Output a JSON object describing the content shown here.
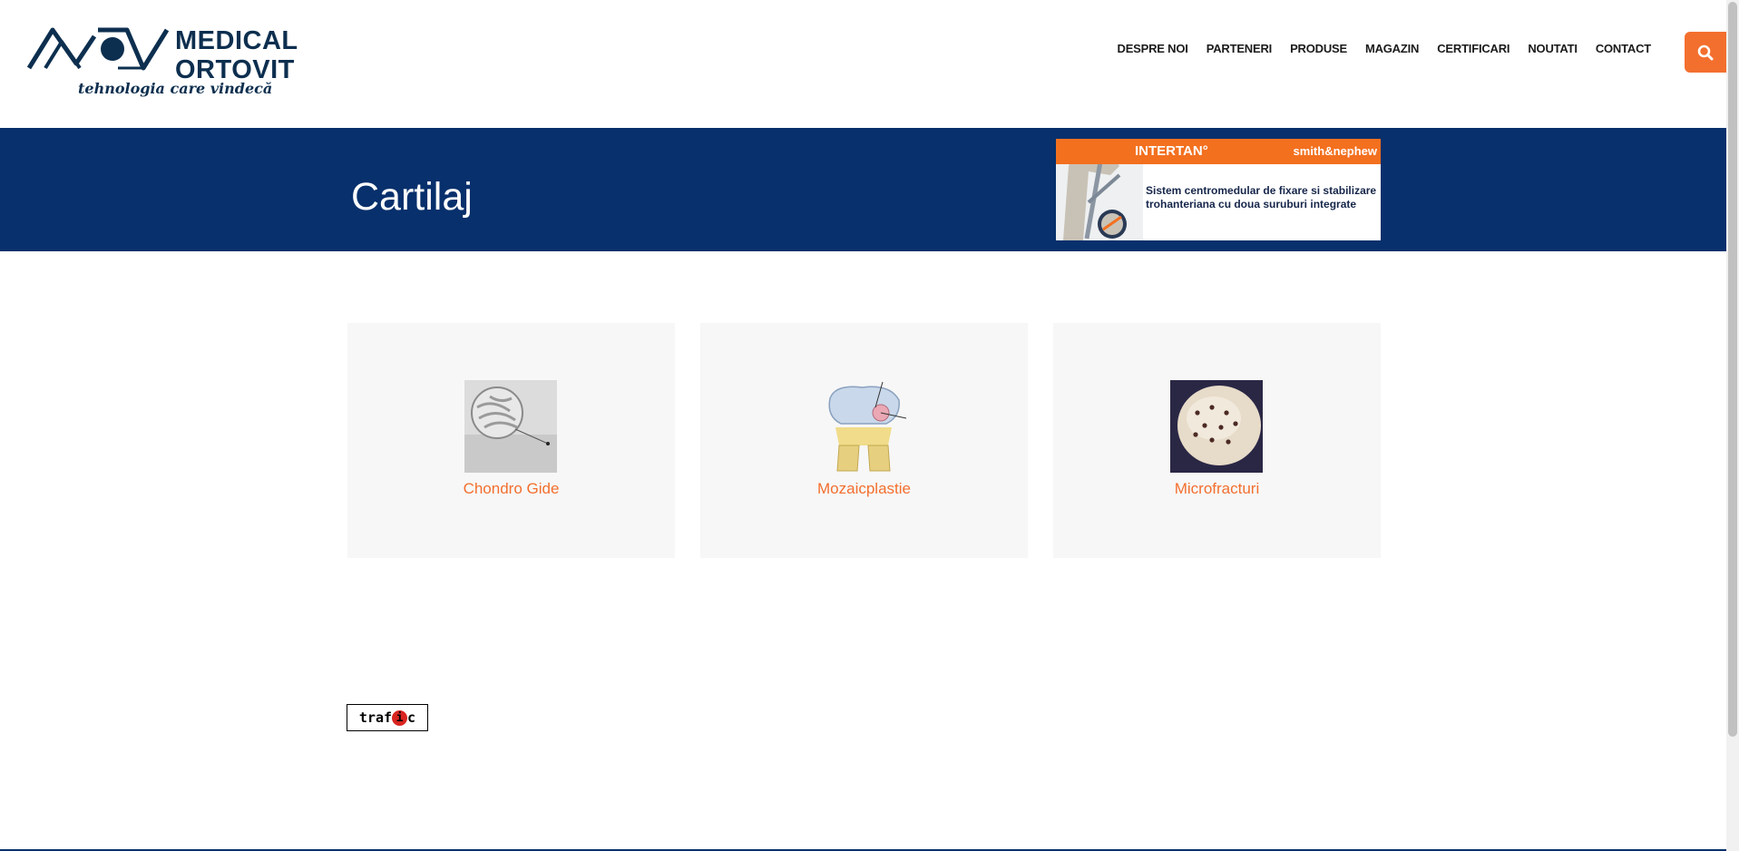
{
  "header": {
    "logo": {
      "word1": "MEDICAL",
      "word2": "ORTOVIT",
      "tagline": "tehnologia care vindecă",
      "icon": "mv-logo-icon"
    },
    "nav": [
      {
        "label": "DESPRE NOI"
      },
      {
        "label": "PARTENERI"
      },
      {
        "label": "PRODUSE"
      },
      {
        "label": "MAGAZIN"
      },
      {
        "label": "CERTIFICARI"
      },
      {
        "label": "NOUTATI"
      },
      {
        "label": "CONTACT"
      }
    ],
    "search_icon": "search-icon"
  },
  "banner": {
    "title": "Cartilaj",
    "ad": {
      "brand": "INTERTAN°",
      "partner": "smith&nephew",
      "line1": "Sistem centromedular de fixare si stabilizare",
      "line2": "trohanteriana cu doua suruburi integrate"
    }
  },
  "cards": [
    {
      "label": "Chondro Gide"
    },
    {
      "label": "Mozaicplastie"
    },
    {
      "label": "Microfracturi"
    }
  ],
  "counter": {
    "pre": "traf",
    "mid": "i",
    "post": "c"
  },
  "colors": {
    "accent": "#f36f2e",
    "banner": "#07306c",
    "logo": "#0d2f4f",
    "card_bg": "#f7f7f7"
  }
}
